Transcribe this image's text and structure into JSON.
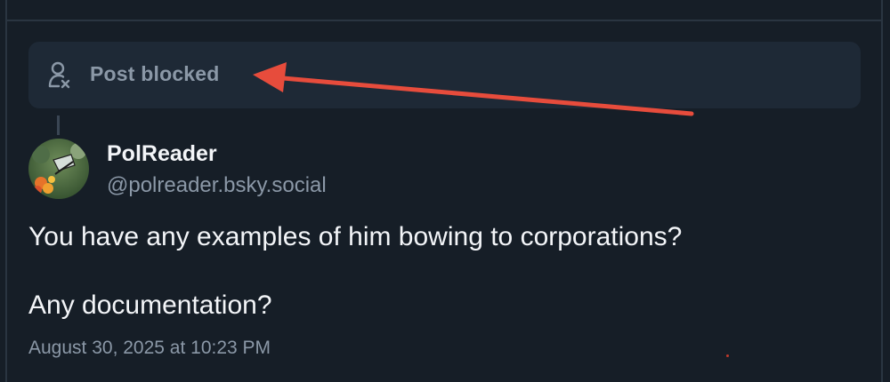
{
  "blocked_notice": {
    "label": "Post blocked",
    "icon": "person-x-icon"
  },
  "post": {
    "author": {
      "display_name": "PolReader",
      "handle": "@polreader.bsky.social",
      "avatar": "butterfly-avatar"
    },
    "text_lines": [
      "You have any examples of him bowing to corporations?",
      "Any documentation?"
    ],
    "timestamp": "August 30, 2025 at 10:23 PM"
  },
  "annotation": {
    "type": "red-arrow",
    "color": "#e74c3c"
  },
  "colors": {
    "background": "#161e27",
    "card": "#1e2936",
    "muted_text": "#8b98a7",
    "primary_text": "#f3f5f8",
    "border": "#2a3541"
  }
}
